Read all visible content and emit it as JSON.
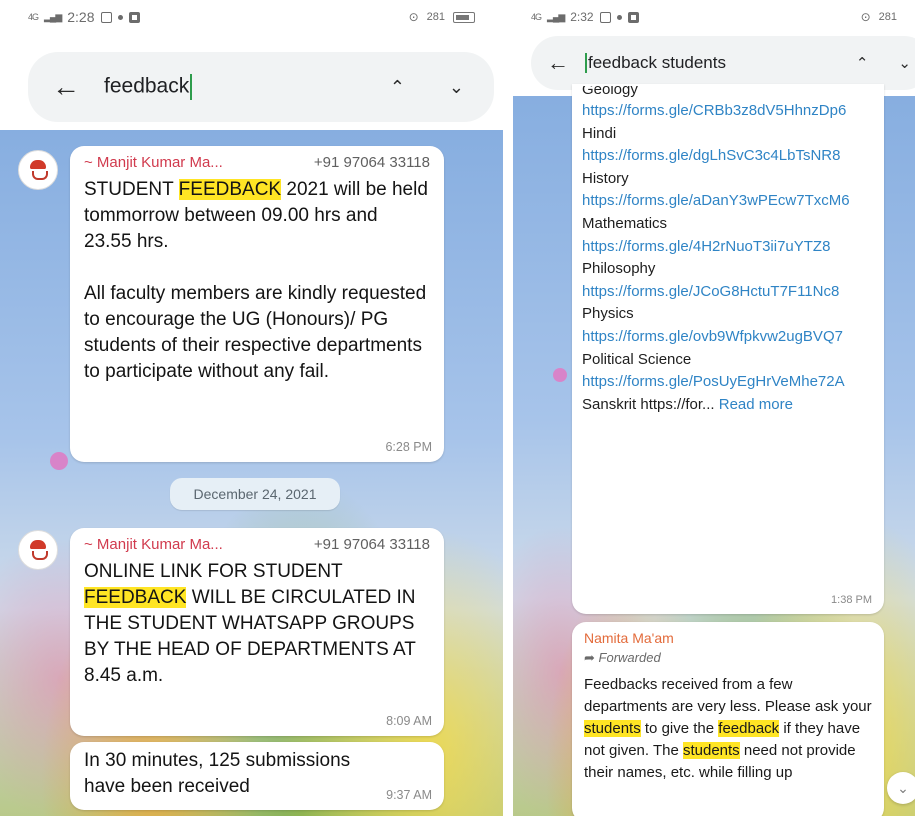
{
  "left": {
    "status": {
      "network": "4G",
      "time": "2:28",
      "right_label": "281"
    },
    "search": {
      "query": "feedback"
    },
    "messages": [
      {
        "sender": "~ Manjit Kumar Ma...",
        "phone": "+91 97064 33118",
        "pre": "STUDENT ",
        "highlight": "FEEDBACK",
        "post": " 2021 will be held tommorrow between 09.00 hrs and 23.55 hrs.\n\nAll faculty members are kindly requested to encourage the UG (Honours)/ PG students of their respective departments to participate without any fail.",
        "time": "6:28 PM"
      },
      {
        "sender": "~ Manjit Kumar Ma...",
        "phone": "+91 97064 33118",
        "pre": "ONLINE LINK FOR STUDENT ",
        "highlight": "FEEDBACK",
        "post": " WILL BE CIRCULATED IN THE STUDENT WHATSAPP GROUPS BY THE HEAD OF DEPARTMENTS AT 8.45 a.m.",
        "time": "8:09 AM"
      },
      {
        "text": "In 30 minutes, 125 submissions have been received",
        "time": "9:37 AM"
      }
    ],
    "date_divider": "December 24, 2021"
  },
  "right": {
    "status": {
      "network": "4G",
      "time": "2:32",
      "right_label": "281"
    },
    "search": {
      "query": "feedback students"
    },
    "list_message": {
      "top_partial": "Geology",
      "items": [
        {
          "link": "https://forms.gle/CRBb3z8dV5HhnzDp6"
        },
        {
          "subject": "Hindi",
          "link": "https://forms.gle/dgLhSvC3c4LbTsNR8"
        },
        {
          "subject": "History",
          "link": "https://forms.gle/aDanY3wPEcw7TxcM6"
        },
        {
          "subject": "Mathematics",
          "link": "https://forms.gle/4H2rNuoT3ii7uYTZ8"
        },
        {
          "subject": "Philosophy",
          "link": "https://forms.gle/JCoG8HctuT7F11Nc8"
        },
        {
          "subject": "Physics",
          "link": "https://forms.gle/ovb9Wfpkvw2ugBVQ7"
        },
        {
          "subject": "Political Science",
          "link": "https://forms.gle/PosUyEgHrVeMhe72A"
        }
      ],
      "last_line": "Sanskrit https://for...",
      "read_more": "Read more",
      "time": "1:38 PM"
    },
    "forward_message": {
      "sender": "Namita Ma'am",
      "forwarded_label": "Forwarded",
      "t1": "Feedbacks received from a few departments are very less. Please ask your ",
      "h1": "students",
      "t2": " to give the ",
      "h2": "feedback",
      "t3": " if they have not given. The ",
      "h3": "students",
      "t4": " need not provide their names, etc. while filling up"
    }
  },
  "icons": {
    "back": "back-arrow-icon",
    "up": "chevron-up-icon",
    "down": "chevron-down-icon",
    "scroll": "double-chevron-down-icon",
    "forward": "forward-arrow-icon"
  },
  "colors": {
    "sender": "#d13b4e",
    "highlight": "#ffe524",
    "link": "#2f84c5",
    "forward_sender": "#e36b3b"
  }
}
